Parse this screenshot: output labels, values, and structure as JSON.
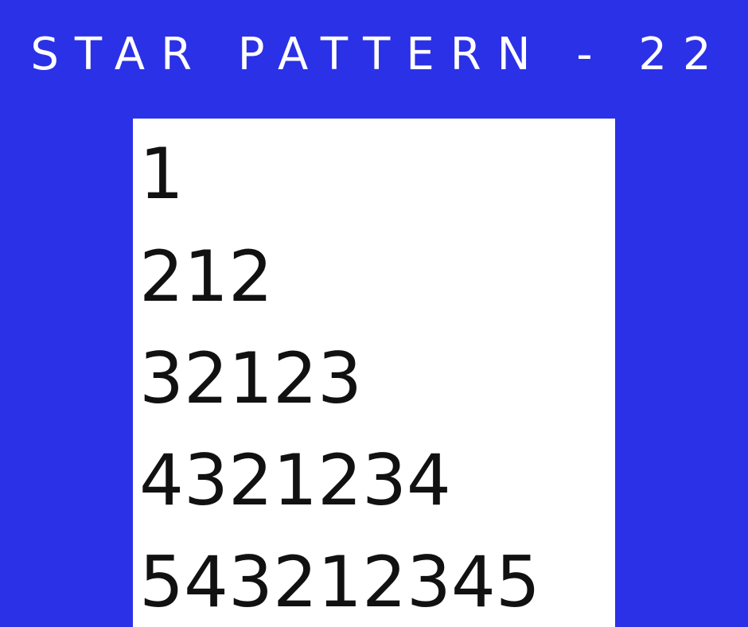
{
  "title": "STAR PATTERN - 22",
  "colors": {
    "background": "#2b31e6",
    "panel": "#ffffff",
    "title_text": "#ffffff",
    "pattern_text": "#111111"
  },
  "pattern": {
    "lines": [
      "1",
      "212",
      "32123",
      "4321234",
      "543212345"
    ]
  }
}
